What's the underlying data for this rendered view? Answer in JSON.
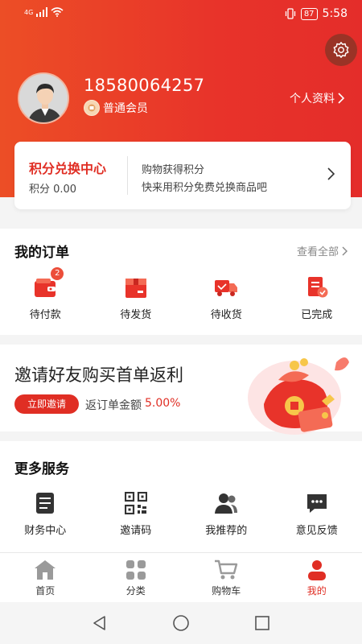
{
  "status_bar": {
    "network": "4G",
    "battery": "87",
    "time": "5:58"
  },
  "header": {
    "phone": "18580064257",
    "member_level": "普通会员",
    "profile_link": "个人资料"
  },
  "points_card": {
    "title": "积分兑换中心",
    "points_label": "积分 0.00",
    "line1": "购物获得积分",
    "line2": "快来用积分免费兑换商品吧"
  },
  "orders": {
    "title": "我的订单",
    "view_all": "查看全部",
    "items": [
      {
        "label": "待付款",
        "badge": "2",
        "icon": "wallet-icon"
      },
      {
        "label": "待发货",
        "icon": "package-icon"
      },
      {
        "label": "待收货",
        "icon": "truck-icon"
      },
      {
        "label": "已完成",
        "icon": "checklist-icon"
      }
    ]
  },
  "invite": {
    "title": "邀请好友购买首单返利",
    "button": "立即邀请",
    "rebate_label": "返订单金额",
    "rebate_value": "5.00%"
  },
  "services": {
    "title": "更多服务",
    "items": [
      {
        "label": "财务中心",
        "icon": "document-icon"
      },
      {
        "label": "邀请码",
        "icon": "qrcode-icon"
      },
      {
        "label": "我推荐的",
        "icon": "users-icon"
      },
      {
        "label": "意见反馈",
        "icon": "chat-icon"
      }
    ]
  },
  "tabbar": {
    "items": [
      {
        "label": "首页",
        "icon": "home-icon"
      },
      {
        "label": "分类",
        "icon": "grid-icon"
      },
      {
        "label": "购物车",
        "icon": "cart-icon"
      },
      {
        "label": "我的",
        "icon": "person-icon",
        "active": true
      }
    ]
  },
  "colors": {
    "accent": "#e02e24",
    "header_start": "#ec4e26",
    "header_end": "#e42d2a"
  }
}
